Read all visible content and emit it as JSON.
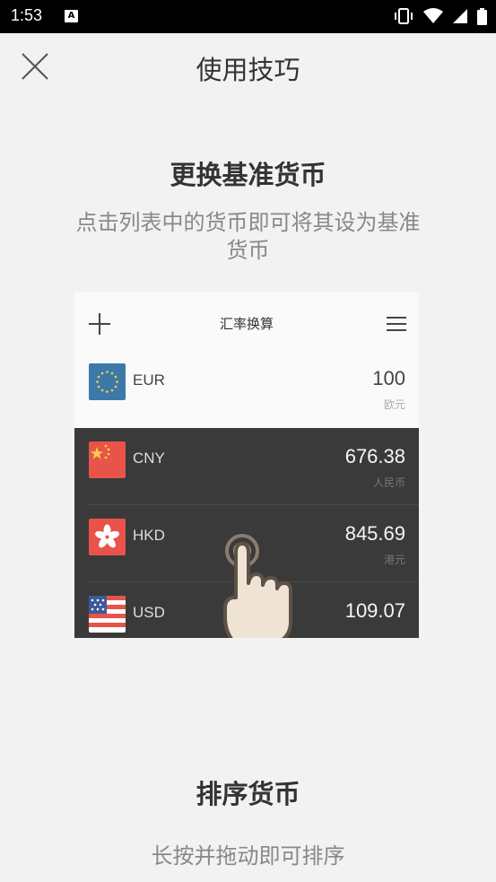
{
  "status": {
    "time": "1:53",
    "notification_letter": "A"
  },
  "header": {
    "title": "使用技巧"
  },
  "tip1": {
    "title": "更换基准货币",
    "desc_line1": "点击列表中的货币即可将其设为基准",
    "desc_line2": "货币"
  },
  "demo": {
    "title": "汇率换算",
    "rows": [
      {
        "code": "EUR",
        "amount": "100",
        "name": "欧元"
      },
      {
        "code": "CNY",
        "amount": "676.38",
        "name": "人民币"
      },
      {
        "code": "HKD",
        "amount": "845.69",
        "name": "港元"
      },
      {
        "code": "USD",
        "amount": "109.07",
        "name": ""
      }
    ]
  },
  "tip2": {
    "title": "排序货币",
    "desc": "长按并拖动即可排序"
  },
  "icons": [
    "close-icon",
    "plus-icon",
    "menu-icon",
    "vibrate-icon",
    "wifi-icon",
    "signal-icon",
    "battery-icon",
    "hand-tap-icon"
  ],
  "colors": {
    "background": "#f2f2f2",
    "dark_panel": "#3a3a3a",
    "eur_flag": "#3d79a8",
    "cny_flag": "#e8534a",
    "hkd_flag": "#e8534a"
  }
}
